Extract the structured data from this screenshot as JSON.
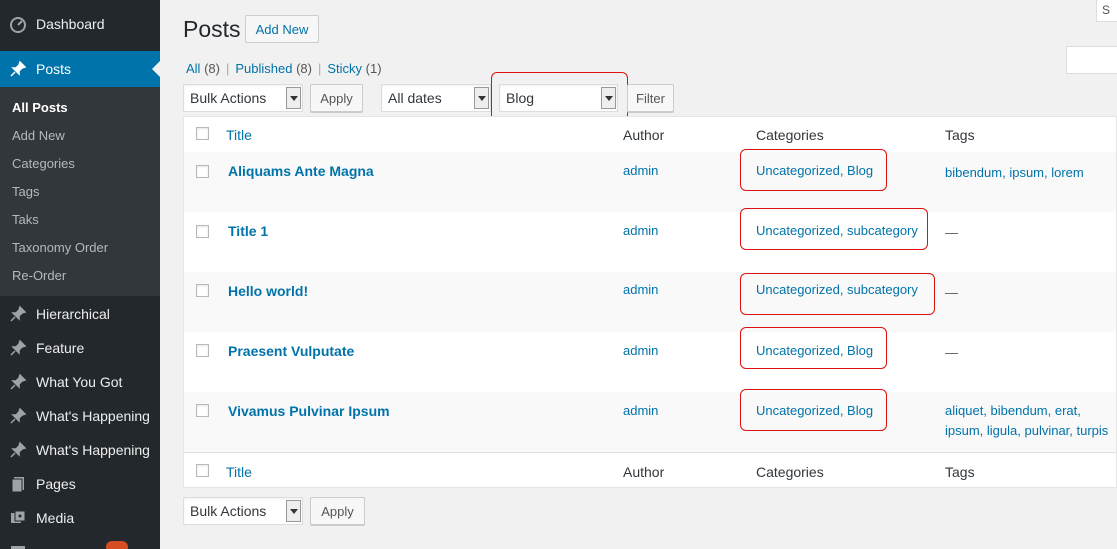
{
  "sidebar": {
    "items": [
      {
        "label": "Dashboard",
        "icon": "dashboard-icon"
      },
      {
        "label": "Posts",
        "icon": "pin-icon"
      },
      {
        "label": "Hierarchical",
        "icon": "pin-icon"
      },
      {
        "label": "Feature",
        "icon": "pin-icon"
      },
      {
        "label": "What You Got",
        "icon": "pin-icon"
      },
      {
        "label": "What's Happening",
        "icon": "pin-icon"
      },
      {
        "label": "What's Happening",
        "icon": "pin-icon"
      },
      {
        "label": "Pages",
        "icon": "pages-icon"
      },
      {
        "label": "Media",
        "icon": "media-icon"
      }
    ],
    "submenu": [
      "All Posts",
      "Add New",
      "Categories",
      "Tags",
      "Taks",
      "Taxonomy Order",
      "Re-Order"
    ]
  },
  "top": {
    "screen_options": "S"
  },
  "header": {
    "title": "Posts",
    "add_new": "Add New"
  },
  "views": {
    "all": "All",
    "all_count": "(8)",
    "published": "Published",
    "published_count": "(8)",
    "sticky": "Sticky",
    "sticky_count": "(1)",
    "separator": "|"
  },
  "filters": {
    "bulk_actions": "Bulk Actions",
    "apply": "Apply",
    "dates": "All dates",
    "category": "Blog",
    "filter": "Filter"
  },
  "table": {
    "columns": {
      "title": "Title",
      "author": "Author",
      "categories": "Categories",
      "tags": "Tags"
    },
    "rows": [
      {
        "title": "Aliquams Ante Magna",
        "author": "admin",
        "categories": "Uncategorized, Blog",
        "tags": "bibendum, ipsum, lorem"
      },
      {
        "title": "Title 1",
        "author": "admin",
        "categories": "Uncategorized, subcategory",
        "tags": "—"
      },
      {
        "title": "Hello world!",
        "author": "admin",
        "categories": "Uncategorized, subcategory",
        "tags": "—"
      },
      {
        "title": "Praesent Vulputate",
        "author": "admin",
        "categories": "Uncategorized, Blog",
        "tags": "—"
      },
      {
        "title": "Vivamus Pulvinar Ipsum",
        "author": "admin",
        "categories": "Uncategorized, Blog",
        "tags": "aliquet, bibendum, erat, ipsum, ligula, pulvinar, turpis"
      }
    ]
  },
  "bottom": {
    "bulk_actions": "Bulk Actions",
    "apply": "Apply"
  },
  "colors": {
    "accent": "#0073aa",
    "sidebar": "#23282d",
    "highlight": "#dd1111"
  }
}
